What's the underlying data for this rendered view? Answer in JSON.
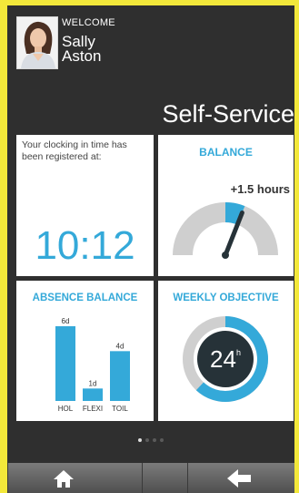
{
  "header": {
    "welcome_label": "WELCOME",
    "user_first_name": "Sally",
    "user_last_name": "Aston"
  },
  "page_title": "Self-Service",
  "clock_tile": {
    "message": "Your clocking in time has been registered at:",
    "time": "10:12"
  },
  "balance_tile": {
    "title": "BALANCE",
    "value": "+1.5 hours",
    "gauge_fraction": 0.62
  },
  "absence_tile": {
    "title": "ABSENCE BALANCE",
    "bars": [
      {
        "label": "HOL",
        "value_label": "6d",
        "value": 6
      },
      {
        "label": "FLEXI",
        "value_label": "1d",
        "value": 1
      },
      {
        "label": "TOIL",
        "value_label": "4d",
        "value": 4
      }
    ]
  },
  "weekly_tile": {
    "title": "WEEKLY OBJECTIVE",
    "value": "24",
    "unit": "h",
    "progress_fraction": 0.62
  },
  "pager": {
    "page_count": 4,
    "active_page": 1
  },
  "nav": {
    "home_icon": "home-icon",
    "back_icon": "back-arrow-icon"
  },
  "colors": {
    "accent": "#34a9d9",
    "background": "#2f2f2f",
    "frame": "#f3e83a",
    "gauge_track": "#cfcfcf",
    "ring_center": "#263238"
  }
}
